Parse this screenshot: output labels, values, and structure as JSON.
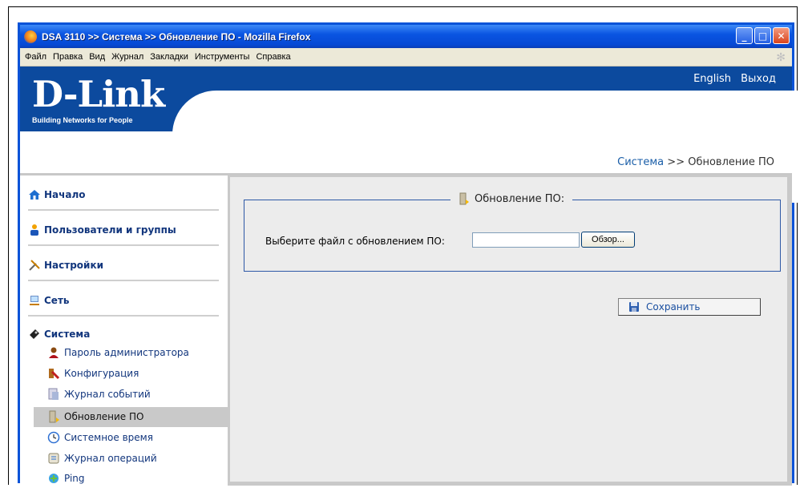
{
  "window": {
    "title": "DSA 3110 >> Система >> Обновление ПО - Mozilla Firefox",
    "controls": {
      "minimize": "_",
      "maximize": "□",
      "close": "✕"
    }
  },
  "menubar": {
    "items": [
      "Файл",
      "Правка",
      "Вид",
      "Журнал",
      "Закладки",
      "Инструменты",
      "Справка"
    ]
  },
  "header": {
    "logo": "D-Link",
    "tagline": "Building Networks for People",
    "links": {
      "english": "English",
      "logout": "Выход"
    },
    "colors": {
      "brand": "#0c4a9e",
      "link": "#1a5ea8"
    }
  },
  "breadcrumb": {
    "section": "Система",
    "separator": ">>",
    "page": "Обновление ПО"
  },
  "sidebar": {
    "sections": [
      {
        "label": "Начало",
        "icon": "home-icon"
      },
      {
        "label": "Пользователи и группы",
        "icon": "users-icon"
      },
      {
        "label": "Настройки",
        "icon": "tools-icon"
      },
      {
        "label": "Сеть",
        "icon": "network-icon"
      },
      {
        "label": "Система",
        "icon": "system-icon"
      }
    ],
    "system_items": [
      {
        "label": "Пароль администратора",
        "icon": "admin-user-icon"
      },
      {
        "label": "Конфигурация",
        "icon": "config-icon"
      },
      {
        "label": "Журнал событий",
        "icon": "event-log-icon"
      },
      {
        "label": "Обновление ПО",
        "icon": "firmware-icon",
        "active": true
      },
      {
        "label": "Системное время",
        "icon": "clock-icon"
      },
      {
        "label": "Журнал операций",
        "icon": "operations-log-icon"
      },
      {
        "label": "Ping",
        "icon": "ping-icon"
      }
    ]
  },
  "main": {
    "legend": "Обновление ПО:",
    "file_label": "Выберите файл с обновлением ПО:",
    "file_value": "",
    "browse_label": "Обзор...",
    "save_label": "Сохранить"
  }
}
